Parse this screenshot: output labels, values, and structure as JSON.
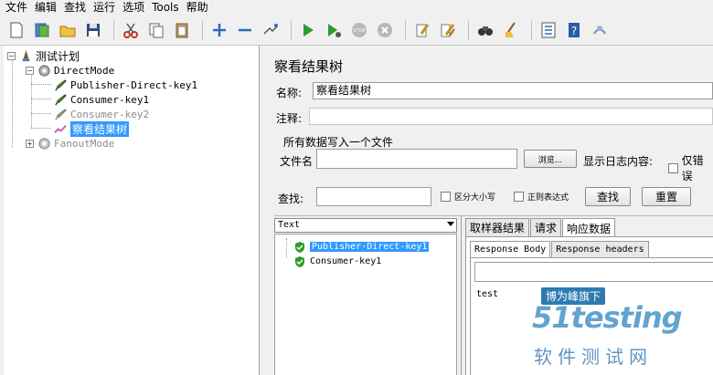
{
  "menubar": {
    "items": [
      "文件",
      "编辑",
      "查找",
      "运行",
      "选项",
      "Tools",
      "帮助"
    ]
  },
  "toolbar": {
    "icons": [
      "new-icon",
      "templates-icon",
      "open-icon",
      "save-icon",
      "cut-icon",
      "copy-icon",
      "paste-icon",
      "expand-icon",
      "collapse-icon",
      "toggle-icon",
      "start-icon",
      "start-no-pause-icon",
      "stop-icon",
      "shutdown-icon",
      "clear-icon",
      "clear-all-icon",
      "search-icon",
      "reset-search-icon",
      "function-helper-icon",
      "help-icon",
      "remote-icon"
    ]
  },
  "tree": {
    "root": "测试计划",
    "direct_mode": "DirectMode",
    "publisher": "Publisher-Direct-key1",
    "consumer1": "Consumer-key1",
    "consumer2": "Consumer-key2",
    "view_results": "察看结果树",
    "fanout_mode": "FanoutMode"
  },
  "panel": {
    "title": "察看结果树",
    "name_label": "名称:",
    "name_value": "察看结果树",
    "comment_label": "注释:",
    "comment_value": "",
    "file_group_title": "所有数据写入一个文件",
    "filename_label": "文件名",
    "filename_value": "",
    "browse_label": "浏览...",
    "log_label": "显示日志内容:",
    "errors_only_label": "仅错误"
  },
  "search": {
    "label": "查找:",
    "value": "",
    "case_label": "区分大小写",
    "regex_label": "正则表达式",
    "find_button": "查找",
    "reset_button": "重置"
  },
  "results": {
    "renderer": "Text",
    "items": [
      "Publisher-Direct-key1",
      "Consumer-key1"
    ],
    "colors": {
      "success": "#2e9a2e",
      "selection": "#3399ff"
    }
  },
  "detail_tabs": {
    "tabs": [
      "取样器结果",
      "请求",
      "响应数据"
    ],
    "subtabs": [
      "Response Body",
      "Response headers"
    ],
    "response_text": "test"
  },
  "watermark": {
    "top": "博为峰旗下",
    "logo": "51testing",
    "sub": "软件测试网"
  }
}
